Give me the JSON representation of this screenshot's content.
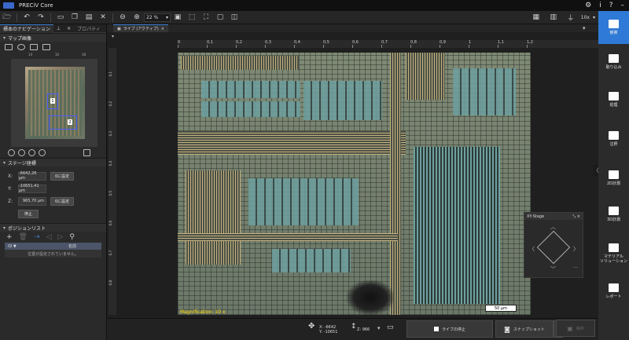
{
  "app": {
    "title": "PRECiV Core"
  },
  "toolbar": {
    "zoom": "22 %",
    "objective": "10x"
  },
  "left_panel": {
    "tabs": [
      "標本のナビゲーション",
      "プロパティ"
    ],
    "map_section": "マップ画像",
    "map_numbers": [
      "1",
      "2"
    ],
    "ruler_top": [
      "14",
      "16",
      "18"
    ],
    "stage_section": "ステージ座標",
    "stage": [
      {
        "axis": "X:",
        "value": "-6642,26 µm",
        "button": "0に設定"
      },
      {
        "axis": "Y:",
        "value": "-10651,41 µm",
        "button": ""
      },
      {
        "axis": "Z:",
        "value": "965,70 µm",
        "button": "0に設定"
      }
    ],
    "stop_button": "停止",
    "position_section": "ポジションリスト",
    "table_headers": [
      "ID ▼",
      "名前"
    ],
    "table_empty": "位置が設定されていません。"
  },
  "view": {
    "tab_label": "ライブ (アクティブ)",
    "hruler": [
      "0",
      "0,1",
      "0,2",
      "0,3",
      "0,4",
      "0,5",
      "0,6",
      "0,7",
      "0,8",
      "0,9",
      "1",
      "1,1",
      "1,2"
    ],
    "vruler": [
      "0,1",
      "0,2",
      "0,3",
      "0,4",
      "0,5",
      "0,6",
      "0,7",
      "0,8"
    ],
    "magnification": "Magnification:  10 x",
    "scalebar": "50 µm"
  },
  "xy_stage": {
    "title": "XY-Stage"
  },
  "bottom": {
    "x": "X: -6642",
    "y": "Y: -10651",
    "z": "Z: 966",
    "stop_live": "ライブの停止",
    "snapshot": "スナップショット",
    "save": "保存"
  },
  "right_nav": [
    {
      "label": "観察"
    },
    {
      "label": "取り込み"
    },
    {
      "label": "処理"
    },
    {
      "label": "注釈"
    },
    {
      "label": "2D計測"
    },
    {
      "label": "3D計測"
    },
    {
      "label": "マテリアル\nソリューション"
    },
    {
      "label": "レポート"
    }
  ]
}
